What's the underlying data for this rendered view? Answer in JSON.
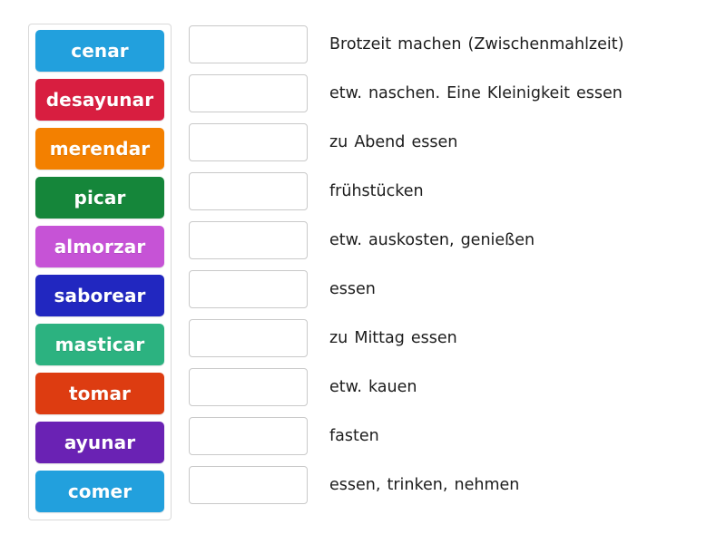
{
  "activity": {
    "type": "match-up",
    "tiles_tray": {
      "label": "word-tiles"
    },
    "tiles": [
      {
        "label": "cenar",
        "color": "#22a0dd"
      },
      {
        "label": "desayunar",
        "color": "#d81e40"
      },
      {
        "label": "merendar",
        "color": "#f38000"
      },
      {
        "label": "picar",
        "color": "#15863a"
      },
      {
        "label": "almorzar",
        "color": "#c653d6"
      },
      {
        "label": "saborear",
        "color": "#2127c0"
      },
      {
        "label": "masticar",
        "color": "#2cb280"
      },
      {
        "label": "tomar",
        "color": "#dd3c11"
      },
      {
        "label": "ayunar",
        "color": "#6a22b4"
      },
      {
        "label": "comer",
        "color": "#22a0dd"
      }
    ],
    "rows": [
      {
        "answer": "",
        "placeholder": "",
        "definition": "Brotzeit machen (Zwischenmahlzeit)"
      },
      {
        "answer": "",
        "placeholder": "",
        "definition": "etw. naschen. Eine Kleinigkeit essen"
      },
      {
        "answer": "",
        "placeholder": "",
        "definition": "zu Abend essen"
      },
      {
        "answer": "",
        "placeholder": "",
        "definition": "frühstücken"
      },
      {
        "answer": "",
        "placeholder": "",
        "definition": "etw. auskosten, genießen"
      },
      {
        "answer": "",
        "placeholder": "",
        "definition": "essen"
      },
      {
        "answer": "",
        "placeholder": "",
        "definition": "zu Mittag essen"
      },
      {
        "answer": "",
        "placeholder": "",
        "definition": "etw. kauen"
      },
      {
        "answer": "",
        "placeholder": "",
        "definition": "fasten"
      },
      {
        "answer": "",
        "placeholder": "",
        "definition": "essen, trinken, nehmen"
      }
    ]
  }
}
